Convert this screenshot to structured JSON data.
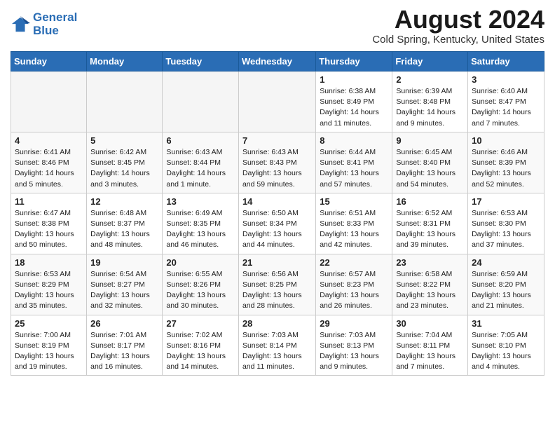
{
  "header": {
    "logo_line1": "General",
    "logo_line2": "Blue",
    "month_title": "August 2024",
    "subtitle": "Cold Spring, Kentucky, United States"
  },
  "days_of_week": [
    "Sunday",
    "Monday",
    "Tuesday",
    "Wednesday",
    "Thursday",
    "Friday",
    "Saturday"
  ],
  "weeks": [
    [
      {
        "day": "",
        "info": ""
      },
      {
        "day": "",
        "info": ""
      },
      {
        "day": "",
        "info": ""
      },
      {
        "day": "",
        "info": ""
      },
      {
        "day": "1",
        "info": "Sunrise: 6:38 AM\nSunset: 8:49 PM\nDaylight: 14 hours\nand 11 minutes."
      },
      {
        "day": "2",
        "info": "Sunrise: 6:39 AM\nSunset: 8:48 PM\nDaylight: 14 hours\nand 9 minutes."
      },
      {
        "day": "3",
        "info": "Sunrise: 6:40 AM\nSunset: 8:47 PM\nDaylight: 14 hours\nand 7 minutes."
      }
    ],
    [
      {
        "day": "4",
        "info": "Sunrise: 6:41 AM\nSunset: 8:46 PM\nDaylight: 14 hours\nand 5 minutes."
      },
      {
        "day": "5",
        "info": "Sunrise: 6:42 AM\nSunset: 8:45 PM\nDaylight: 14 hours\nand 3 minutes."
      },
      {
        "day": "6",
        "info": "Sunrise: 6:43 AM\nSunset: 8:44 PM\nDaylight: 14 hours\nand 1 minute."
      },
      {
        "day": "7",
        "info": "Sunrise: 6:43 AM\nSunset: 8:43 PM\nDaylight: 13 hours\nand 59 minutes."
      },
      {
        "day": "8",
        "info": "Sunrise: 6:44 AM\nSunset: 8:41 PM\nDaylight: 13 hours\nand 57 minutes."
      },
      {
        "day": "9",
        "info": "Sunrise: 6:45 AM\nSunset: 8:40 PM\nDaylight: 13 hours\nand 54 minutes."
      },
      {
        "day": "10",
        "info": "Sunrise: 6:46 AM\nSunset: 8:39 PM\nDaylight: 13 hours\nand 52 minutes."
      }
    ],
    [
      {
        "day": "11",
        "info": "Sunrise: 6:47 AM\nSunset: 8:38 PM\nDaylight: 13 hours\nand 50 minutes."
      },
      {
        "day": "12",
        "info": "Sunrise: 6:48 AM\nSunset: 8:37 PM\nDaylight: 13 hours\nand 48 minutes."
      },
      {
        "day": "13",
        "info": "Sunrise: 6:49 AM\nSunset: 8:35 PM\nDaylight: 13 hours\nand 46 minutes."
      },
      {
        "day": "14",
        "info": "Sunrise: 6:50 AM\nSunset: 8:34 PM\nDaylight: 13 hours\nand 44 minutes."
      },
      {
        "day": "15",
        "info": "Sunrise: 6:51 AM\nSunset: 8:33 PM\nDaylight: 13 hours\nand 42 minutes."
      },
      {
        "day": "16",
        "info": "Sunrise: 6:52 AM\nSunset: 8:31 PM\nDaylight: 13 hours\nand 39 minutes."
      },
      {
        "day": "17",
        "info": "Sunrise: 6:53 AM\nSunset: 8:30 PM\nDaylight: 13 hours\nand 37 minutes."
      }
    ],
    [
      {
        "day": "18",
        "info": "Sunrise: 6:53 AM\nSunset: 8:29 PM\nDaylight: 13 hours\nand 35 minutes."
      },
      {
        "day": "19",
        "info": "Sunrise: 6:54 AM\nSunset: 8:27 PM\nDaylight: 13 hours\nand 32 minutes."
      },
      {
        "day": "20",
        "info": "Sunrise: 6:55 AM\nSunset: 8:26 PM\nDaylight: 13 hours\nand 30 minutes."
      },
      {
        "day": "21",
        "info": "Sunrise: 6:56 AM\nSunset: 8:25 PM\nDaylight: 13 hours\nand 28 minutes."
      },
      {
        "day": "22",
        "info": "Sunrise: 6:57 AM\nSunset: 8:23 PM\nDaylight: 13 hours\nand 26 minutes."
      },
      {
        "day": "23",
        "info": "Sunrise: 6:58 AM\nSunset: 8:22 PM\nDaylight: 13 hours\nand 23 minutes."
      },
      {
        "day": "24",
        "info": "Sunrise: 6:59 AM\nSunset: 8:20 PM\nDaylight: 13 hours\nand 21 minutes."
      }
    ],
    [
      {
        "day": "25",
        "info": "Sunrise: 7:00 AM\nSunset: 8:19 PM\nDaylight: 13 hours\nand 19 minutes."
      },
      {
        "day": "26",
        "info": "Sunrise: 7:01 AM\nSunset: 8:17 PM\nDaylight: 13 hours\nand 16 minutes."
      },
      {
        "day": "27",
        "info": "Sunrise: 7:02 AM\nSunset: 8:16 PM\nDaylight: 13 hours\nand 14 minutes."
      },
      {
        "day": "28",
        "info": "Sunrise: 7:03 AM\nSunset: 8:14 PM\nDaylight: 13 hours\nand 11 minutes."
      },
      {
        "day": "29",
        "info": "Sunrise: 7:03 AM\nSunset: 8:13 PM\nDaylight: 13 hours\nand 9 minutes."
      },
      {
        "day": "30",
        "info": "Sunrise: 7:04 AM\nSunset: 8:11 PM\nDaylight: 13 hours\nand 7 minutes."
      },
      {
        "day": "31",
        "info": "Sunrise: 7:05 AM\nSunset: 8:10 PM\nDaylight: 13 hours\nand 4 minutes."
      }
    ]
  ]
}
